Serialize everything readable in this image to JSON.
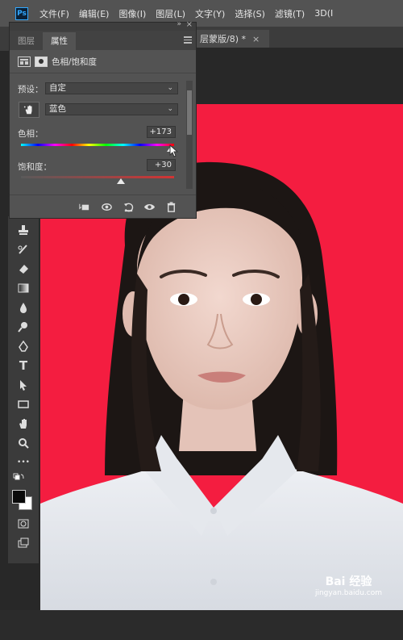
{
  "app": {
    "logo_text": "Ps",
    "menu": [
      "文件(F)",
      "编辑(E)",
      "图像(I)",
      "图层(L)",
      "文字(Y)",
      "选择(S)",
      "滤镜(T)",
      "3D(I"
    ],
    "document_tab": "层蒙版/8) *",
    "document_tab_close": "×"
  },
  "panel": {
    "tabs": [
      "图层",
      "属性"
    ],
    "active_tab": "属性",
    "adjustment_title": "色相/饱和度",
    "preset_label": "预设：",
    "preset_value": "自定",
    "channel_value": "蓝色",
    "hue_label": "色相：",
    "hue_value": "+173",
    "saturation_label": "饱和度：",
    "saturation_value": "+30",
    "colors": {
      "panel_bg": "#535353",
      "canvas_bg": "#f41d40"
    }
  },
  "tools": {
    "icons": [
      "stamp-icon",
      "history-brush-icon",
      "eraser-icon",
      "gradient-icon",
      "blur-icon",
      "dodge-icon",
      "pen-icon",
      "type-icon",
      "path-select-icon",
      "rectangle-icon",
      "hand-icon",
      "zoom-icon",
      "more-tools-icon",
      "swap-colors-icon",
      "foreground-background-colors",
      "quick-mask-icon",
      "screen-mode-icon"
    ],
    "type_glyph": "T",
    "more_glyph": "•••"
  },
  "watermark": {
    "line1": "Bai 经验",
    "line2": "jingyan.baidu.com"
  }
}
